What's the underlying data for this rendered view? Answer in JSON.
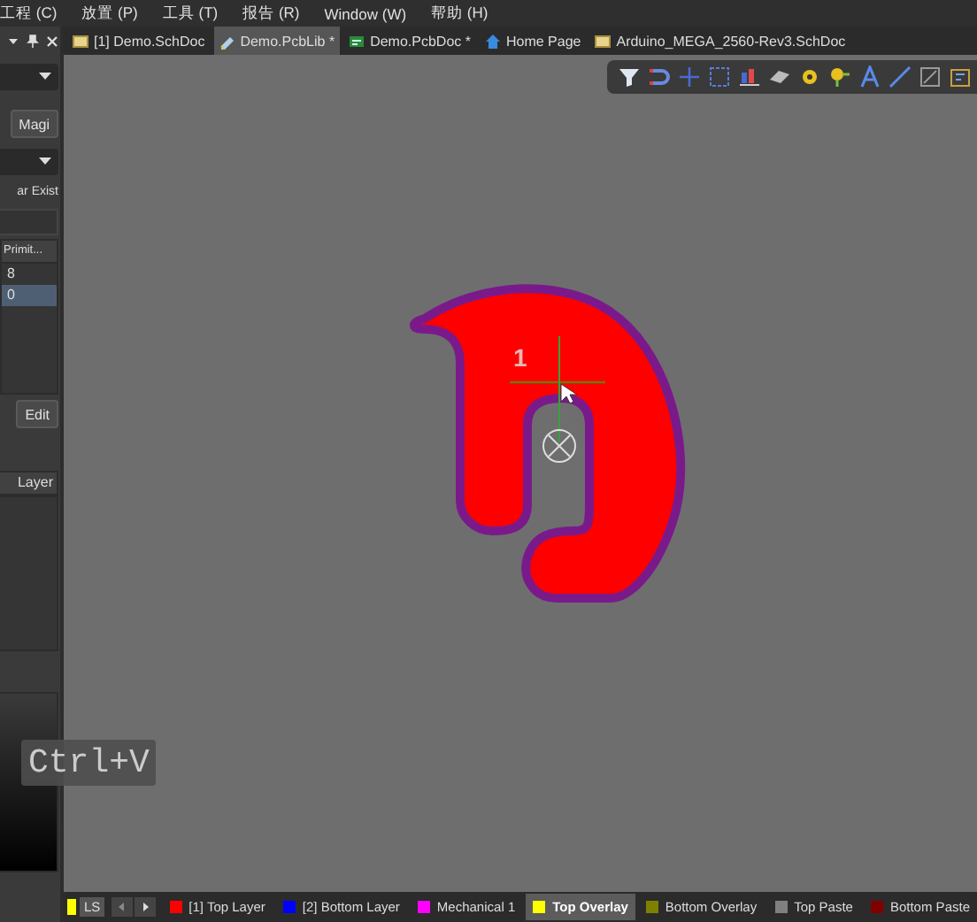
{
  "menu": [
    {
      "label": "工程 (C)"
    },
    {
      "label": "放置 (P)"
    },
    {
      "label": "工具 (T)"
    },
    {
      "label": "报告 (R)"
    },
    {
      "label": "Window (W)"
    },
    {
      "label": "帮助 (H)"
    }
  ],
  "panel": {
    "magic_button": "Magi",
    "filter_text": "ar Exist",
    "column": "Primit...",
    "rows": [
      {
        "text": "8",
        "selected": false
      },
      {
        "text": "0",
        "selected": true
      }
    ],
    "edit_button": "Edit",
    "layer_header": "Layer"
  },
  "documents": [
    {
      "label": "[1] Demo.SchDoc",
      "kind": "sch",
      "selected": false
    },
    {
      "label": "Demo.PcbLib *",
      "kind": "lib",
      "selected": true
    },
    {
      "label": "Demo.PcbDoc *",
      "kind": "pcb",
      "selected": false
    },
    {
      "label": "Home Page",
      "kind": "home",
      "selected": false
    },
    {
      "label": "Arduino_MEGA_2560-Rev3.SchDoc",
      "kind": "sch",
      "selected": false
    }
  ],
  "toolbar": [
    {
      "kind": "filter"
    },
    {
      "kind": "magnet"
    },
    {
      "kind": "cross"
    },
    {
      "kind": "rect"
    },
    {
      "kind": "chart"
    },
    {
      "kind": "eraser"
    },
    {
      "kind": "pad"
    },
    {
      "kind": "via"
    },
    {
      "kind": "text"
    },
    {
      "kind": "line"
    },
    {
      "kind": "square"
    },
    {
      "kind": "box"
    }
  ],
  "canvas": {
    "pad_designator": "1"
  },
  "layer_bar": {
    "ls": "LS",
    "layers": [
      {
        "label": "[1] Top Layer",
        "color": "#ff0000",
        "selected": false
      },
      {
        "label": "[2] Bottom Layer",
        "color": "#0000ff",
        "selected": false
      },
      {
        "label": "Mechanical 1",
        "color": "#ff00ff",
        "selected": false
      },
      {
        "label": "Top Overlay",
        "color": "#ffff00",
        "selected": true
      },
      {
        "label": "Bottom Overlay",
        "color": "#808000",
        "selected": false
      },
      {
        "label": "Top Paste",
        "color": "#808080",
        "selected": false
      },
      {
        "label": "Bottom Paste",
        "color": "#800000",
        "selected": false
      }
    ]
  },
  "key_overlay": "Ctrl+V"
}
